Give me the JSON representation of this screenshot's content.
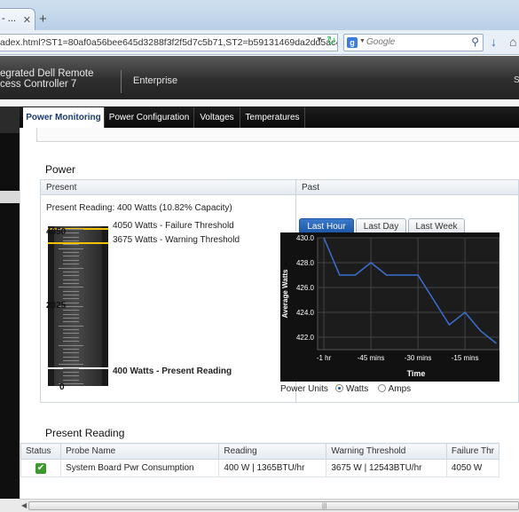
{
  "browser": {
    "tab_title": "- ...",
    "new_tab": "+",
    "url": "adex.html?ST1=80af0a56bee645d3288f3f2f5d7c5b71,ST2=b59131469da2dd5ac483453d44ec01",
    "search_placeholder": "Google"
  },
  "header": {
    "brand_line1": "egrated Dell Remote",
    "brand_line2": "cess Controller 7",
    "edition": "Enterprise",
    "cut_text": "S"
  },
  "tabs": [
    "Power Monitoring",
    "Power Configuration",
    "Voltages",
    "Temperatures"
  ],
  "power": {
    "section_title": "Power",
    "present_head": "Present",
    "past_head": "Past",
    "present_reading": "Present Reading: 400 Watts (10.82% Capacity)",
    "gauge": {
      "max_label": "4050",
      "mid_label": "2025",
      "min_label": "0",
      "max": 4050,
      "failure_value": 4050,
      "warning_value": 3675,
      "present_value": 400,
      "failure_label": "4050 Watts - Failure Threshold",
      "warning_label": "3675 Watts - Warning Threshold",
      "present_label": "400 Watts - Present Reading"
    },
    "past_tabs": [
      "Last Hour",
      "Last Day",
      "Last Week"
    ],
    "power_units_label": "Power Units",
    "unit_watts": "Watts",
    "unit_amps": "Amps"
  },
  "chart_data": {
    "type": "line",
    "ylabel": "Average Watts",
    "xlabel": "Time",
    "ylim": [
      421,
      430
    ],
    "yticks": [
      "430.0",
      "428.0",
      "426.0",
      "424.0",
      "422.0"
    ],
    "ytick_values": [
      430,
      428,
      426,
      424,
      422
    ],
    "xticks": [
      "-1 hr",
      "-45 mins",
      "-30 mins",
      "-15 mins"
    ],
    "xtick_values": [
      -60,
      -45,
      -30,
      -15
    ],
    "xlim": [
      -62,
      -4
    ],
    "grid": true,
    "series": [
      {
        "x": [
          -60,
          -55,
          -50,
          -45,
          -40,
          -35,
          -30,
          -25,
          -20,
          -15,
          -10,
          -5
        ],
        "y": [
          430,
          427,
          427,
          428,
          427,
          427,
          427,
          425,
          423,
          424,
          422.5,
          421.5
        ]
      }
    ]
  },
  "present_table": {
    "title": "Present Reading",
    "columns": [
      "Status",
      "Probe Name",
      "Reading",
      "Warning Threshold",
      "Failure Thr"
    ],
    "rows": [
      {
        "status": "✔",
        "probe": "System Board Pwr Consumption",
        "reading": "400 W  |  1365BTU/hr",
        "warning": "3675 W  |  12543BTU/hr",
        "failure": "4050 W"
      }
    ]
  },
  "colors": {
    "accent": "#1b57a5",
    "chart_line": "#3b6fd1",
    "failure_line": "#f2c200",
    "present_line": "#ffffff"
  }
}
